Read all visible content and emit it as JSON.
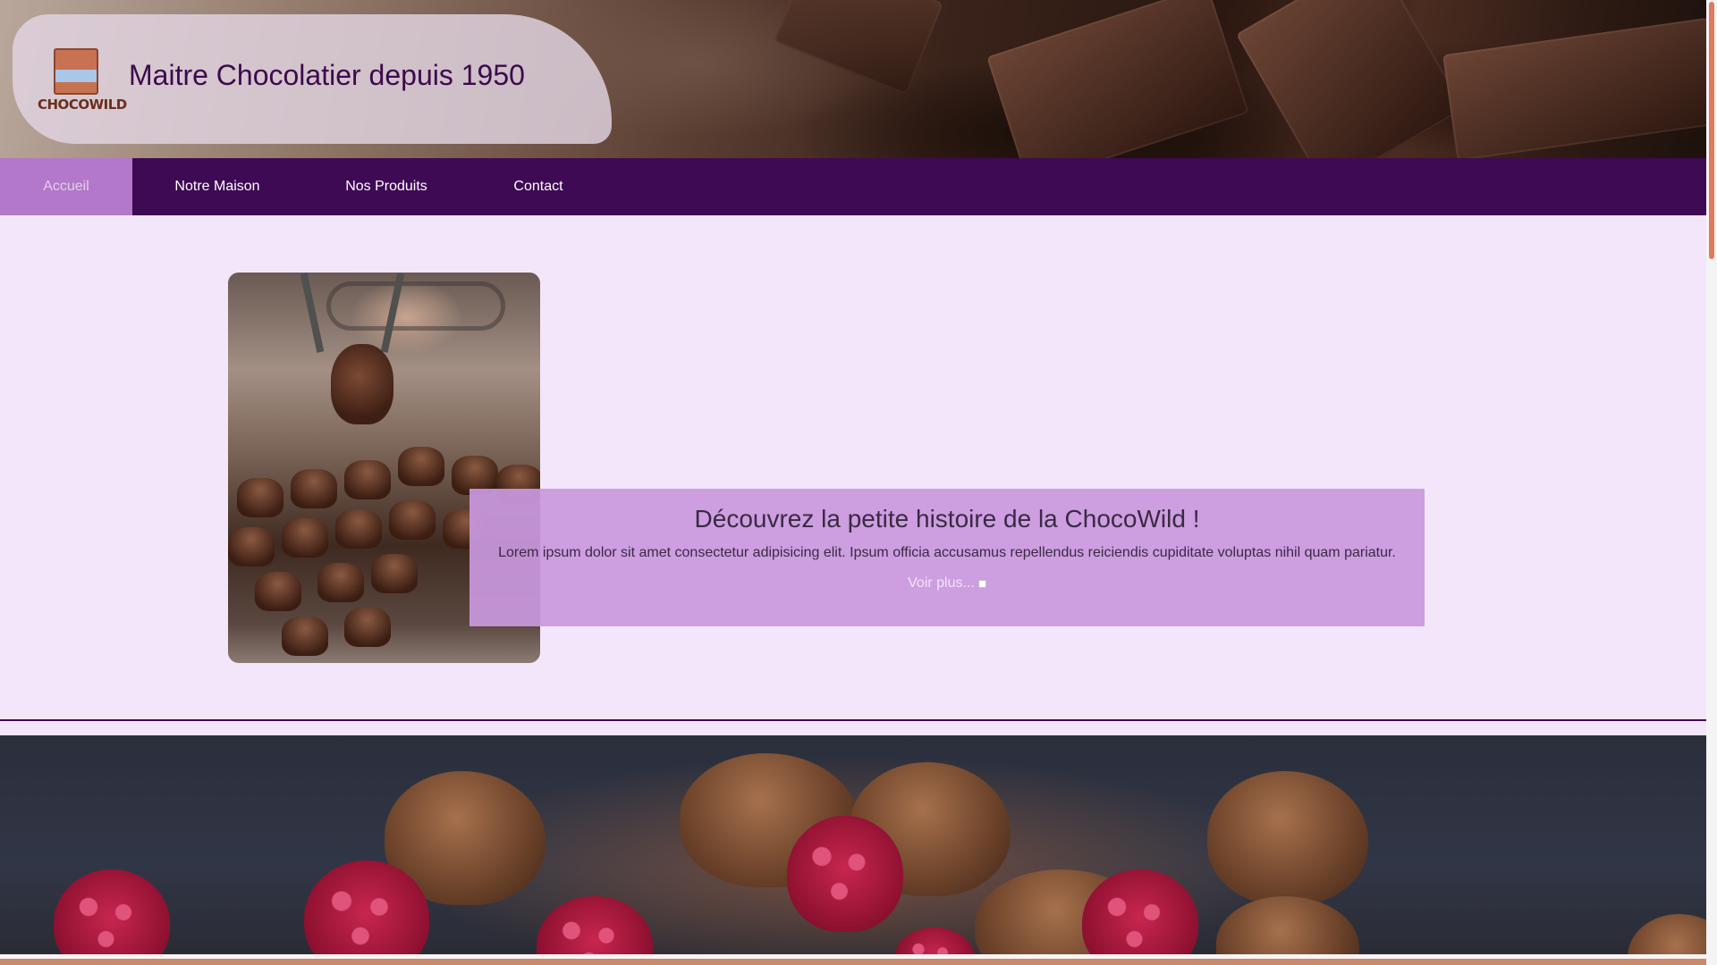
{
  "header": {
    "logo_text": "CHOCOWILD",
    "title": "Maitre Chocolatier depuis 1950"
  },
  "nav": {
    "items": [
      {
        "label": "Accueil",
        "active": true
      },
      {
        "label": "Notre Maison",
        "active": false
      },
      {
        "label": "Nos Produits",
        "active": false
      },
      {
        "label": "Contact",
        "active": false
      }
    ]
  },
  "story": {
    "title": "Découvrez la petite histoire de la ChocoWild !",
    "text": "Lorem ipsum dolor sit amet consectetur adipisicing elit. Ipsum officia accusamus repellendus reiciendis cupiditate voluptas nihil quam pariatur.",
    "link_label": "Voir plus..."
  },
  "colors": {
    "nav_bg": "#3e0a54",
    "nav_active": "#b378c9",
    "page_bg": "#f3e6fb",
    "card_bg": "#c998de",
    "title_color": "#3c0a4d",
    "scrollbar_thumb": "#e07a5a"
  },
  "icons": {
    "logo": "chocolate-bar-logo-icon",
    "link_marker": "checkbox-icon"
  }
}
